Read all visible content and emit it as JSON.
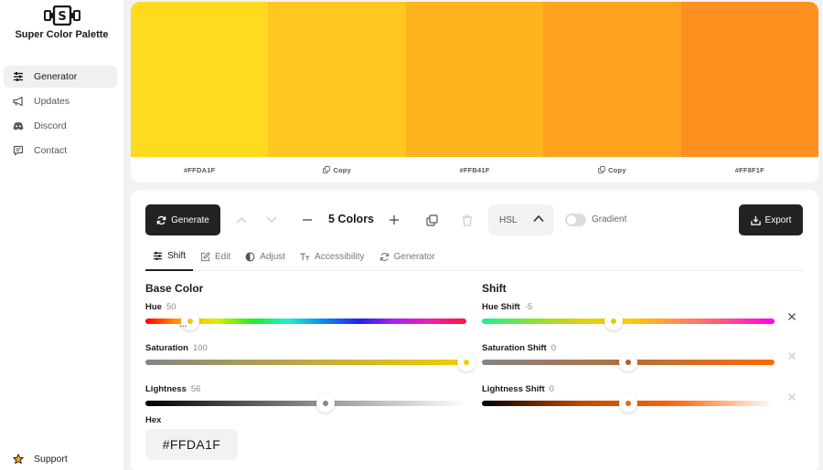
{
  "app": {
    "title": "Super Color Palette"
  },
  "sidebar": {
    "items": [
      {
        "label": "Generator",
        "icon": "sliders-icon",
        "active": true
      },
      {
        "label": "Updates",
        "icon": "megaphone-icon",
        "active": false
      },
      {
        "label": "Discord",
        "icon": "discord-icon",
        "active": false
      },
      {
        "label": "Contact",
        "icon": "message-icon",
        "active": false
      }
    ],
    "support_label": "Support"
  },
  "palette": {
    "swatches": [
      {
        "color": "#FFDA1F",
        "label": "#FFDA1F"
      },
      {
        "color": "#FFC720",
        "label": "Copy"
      },
      {
        "color": "#FFB41F",
        "label": "#FFB41F"
      },
      {
        "color": "#FFA220",
        "label": "Copy"
      },
      {
        "color": "#FF8F1F",
        "label": "#FF8F1F"
      }
    ]
  },
  "toolbar": {
    "generate_label": "Generate",
    "color_count_label": "5 Colors",
    "mode_select": "HSL",
    "gradient_label": "Gradient",
    "gradient_on": false,
    "export_label": "Export"
  },
  "tabs": [
    {
      "label": "Shift",
      "icon": "sliders-icon",
      "active": true
    },
    {
      "label": "Edit",
      "icon": "edit-icon",
      "active": false
    },
    {
      "label": "Adjust",
      "icon": "contrast-icon",
      "active": false
    },
    {
      "label": "Accessibility",
      "icon": "text-size-icon",
      "active": false
    },
    {
      "label": "Generator",
      "icon": "refresh-icon",
      "active": false
    }
  ],
  "base_color": {
    "title": "Base Color",
    "hue": {
      "label": "Hue",
      "value": "50",
      "fraction": 0.139
    },
    "saturation": {
      "label": "Saturation",
      "value": "100",
      "fraction": 1.0
    },
    "lightness": {
      "label": "Lightness",
      "value": "56",
      "fraction": 0.56
    },
    "hex_label": "Hex",
    "hex_value": "#FFDA1F"
  },
  "shift": {
    "title": "Shift",
    "hue_shift": {
      "label": "Hue Shift",
      "value": "-5",
      "fraction": 0.45
    },
    "saturation_shift": {
      "label": "Saturation Shift",
      "value": "0",
      "fraction": 0.5
    },
    "lightness_shift": {
      "label": "Lightness Shift",
      "value": "0",
      "fraction": 0.5
    }
  },
  "colors": {
    "dark_button": "#222222",
    "base_thumb": "#E8C81C",
    "sat_thumb": "#F5C800",
    "light_thumb": "#888888",
    "shift_thumb": "#E0C81A",
    "shift_orange_thumb": "#E8651A"
  }
}
